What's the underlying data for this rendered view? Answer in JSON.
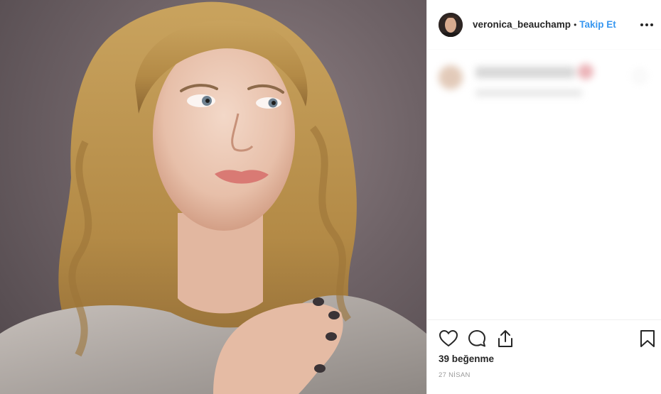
{
  "post": {
    "photo": {
      "description_icon": "portrait-photo"
    },
    "header": {
      "username": "veronica_beauchamp",
      "separator": "•",
      "follow_label": "Takip Et",
      "more_icon": "more-options-icon"
    },
    "actions": {
      "icons": [
        "heart-icon",
        "comment-icon",
        "share-icon",
        "bookmark-icon"
      ],
      "likes_text": "39 beğenme",
      "date_text": "27 NİSAN"
    },
    "colors": {
      "link_blue": "#3897f0",
      "text_dark": "#262626",
      "text_muted": "#999999"
    }
  }
}
